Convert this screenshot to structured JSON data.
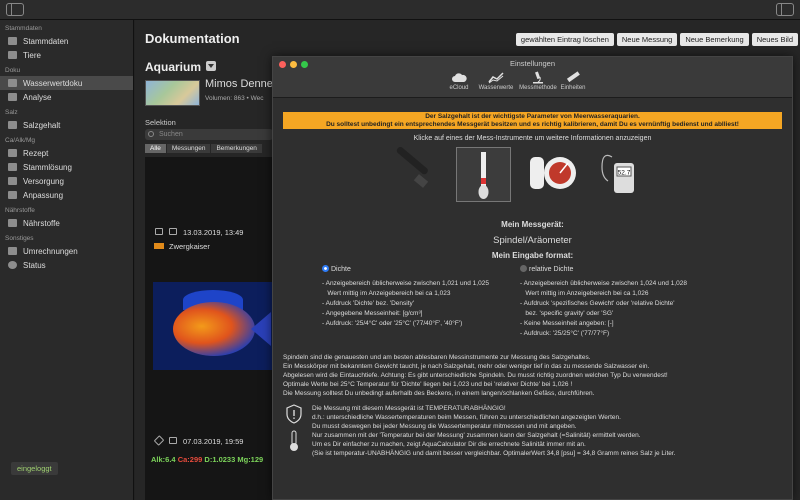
{
  "sidebar": {
    "sections": [
      {
        "title": "Stammdaten",
        "items": [
          {
            "label": "Stammdaten",
            "icon": "database-icon"
          },
          {
            "label": "Tiere",
            "icon": "animal-icon"
          }
        ]
      },
      {
        "title": "Doku",
        "items": [
          {
            "label": "Wasserwertdoku",
            "icon": "doc-icon",
            "active": true
          },
          {
            "label": "Analyse",
            "icon": "chart-icon"
          }
        ]
      },
      {
        "title": "Salz",
        "items": [
          {
            "label": "Salzgehalt",
            "icon": "salt-icon"
          }
        ]
      },
      {
        "title": "Ca/Alk/Mg",
        "items": [
          {
            "label": "Rezept",
            "icon": "recipe-icon"
          },
          {
            "label": "Stammlösung",
            "icon": "solution-icon"
          },
          {
            "label": "Versorgung",
            "icon": "supply-icon"
          },
          {
            "label": "Anpassung",
            "icon": "adjust-icon"
          }
        ]
      },
      {
        "title": "Nährstoffe",
        "items": [
          {
            "label": "Nährstoffe",
            "icon": "nutrient-icon"
          }
        ]
      },
      {
        "title": "Sonstiges",
        "items": [
          {
            "label": "Umrechnungen",
            "icon": "convert-icon"
          },
          {
            "label": "Status",
            "icon": "status-icon"
          }
        ]
      }
    ],
    "status_pill": "eingeloggt"
  },
  "main": {
    "title": "Dokumentation",
    "toolbar": [
      "gewählten Eintrag löschen",
      "Neue Messung",
      "Neue Bemerkung",
      "Neues Bild"
    ],
    "aquarium_label": "Aquarium",
    "aquarium_name": "Mimos Denne",
    "aquarium_volume": "Volumen: 863 • Wec",
    "selection_label": "Selektion",
    "search_placeholder": "Suchen",
    "filters": [
      "Alle",
      "Messungen",
      "Bemerkungen"
    ],
    "entries": [
      {
        "date": "13.03.2019, 13:49",
        "name": "Zwergkaiser"
      },
      {
        "date": "07.03.2019, 19:59"
      }
    ],
    "params": [
      {
        "text": "Alk:6.4",
        "color": "#7cd35a"
      },
      {
        "text": "Ca:299",
        "color": "#e64b3c"
      },
      {
        "text": "D:1.0233",
        "color": "#7cd35a"
      },
      {
        "text": "Mg:129",
        "color": "#7cd35a"
      }
    ]
  },
  "dialog": {
    "title": "Einstellungen",
    "tabs": [
      "eCloud",
      "Wasserwerte",
      "Messmethode",
      "Einheiten"
    ],
    "warning_1": "Der Salzgehalt ist der wichtigste Parameter von Meerwasseraquarien.",
    "warning_2": "Du solltest unbedingt ein entsprechendes Messgerät besitzen und es richtig kalibrieren, damit Du es vernünftig bedienst und ablliest!",
    "hint": "Klicke auf eines der Mess-Instrumente um weitere Informationen anzuzeigen",
    "device_heading": "Mein Messgerät:",
    "device_value": "Spindel/Aräometer",
    "input_heading": "Mein Eingabe format:",
    "radio_left": "Dichte",
    "radio_right": "relative Dichte",
    "bullets_left": "- Anzeigebereich üblicherweise zwischen 1,021 und 1,025\n   Wert mittig im Anzeigebereich bei ca 1,023\n- Aufdruck 'Dichte' bez. 'Density'\n- Angegebene Messeinheit: [g/cm³]\n- Aufdruck: '25/4°C' oder '25°C' ('77/40°F', '40°F')",
    "bullets_right": "- Anzeigebereich üblicherweise zwischen 1,024 und 1,028\n   Wert mittig im Anzeigebereich bei ca 1,026\n- Aufdruck 'spezifisches Gewicht' oder 'relative Dichte'\n   bez. 'specific gravity' oder 'SG'\n- Keine Messeinheit angeben: [-]\n- Aufdruck: '25/25°C' ('77/77°F)",
    "paragraph": "Spindeln sind die genauesten und am besten ablesbaren Messinstrumente zur Messung des Salzgehaltes.\nEin Messkörper mit bekanntem Gewicht taucht, je nach Salzgehalt, mehr oder weniger tief in das zu messende Salzwasser ein.\nAbgelesen wird die Eintauchtiefe. Achtung: Es gibt unterschiedliche Spindeln. Du musst richtig zuordnen welchen Typ Du verwendest!\nOptimale Werte bei 25°C Temperatur für 'Dichte' liegen bei 1,023 und bei 'relativer Dichte' bei 1,026 !\nDie Messung solltest Du unbedingt auferhalb des Beckens, in einem langen/schlanken Gefäss, durchführen.",
    "note": "Die Messung mit diesem Messgerät ist TEMPERATURABHÄNGIG!\nd.h.: unterschiedliche Wassertemperaturen beim Messen, führen zu unterschiedlichen angezeigten Werten.\nDu musst deswegen bei jeder Messung die Wassertemperatur mitmessen und mit angeben.\nNur zusammen mit der 'Temperatur bei der Messung' zusammen kann der Salzgehalt (=Salinität) ermittelt werden.\nUm es Dir einfacher zu machen, zeigt AquaCalculator Dir die errechnete Salinität immer mit an.\n(Sie ist temperatur-UNABHÄNGIG und damit besser vergleichbar. OptimalerWert 34,8 [psu] = 34,8 Gramm reines Salz je Liter.",
    "refractometer_display": "52.7"
  },
  "colors": {
    "warning": "#f5a623",
    "accent_blue": "#2e7cf6",
    "online_green": "#9fd070"
  }
}
